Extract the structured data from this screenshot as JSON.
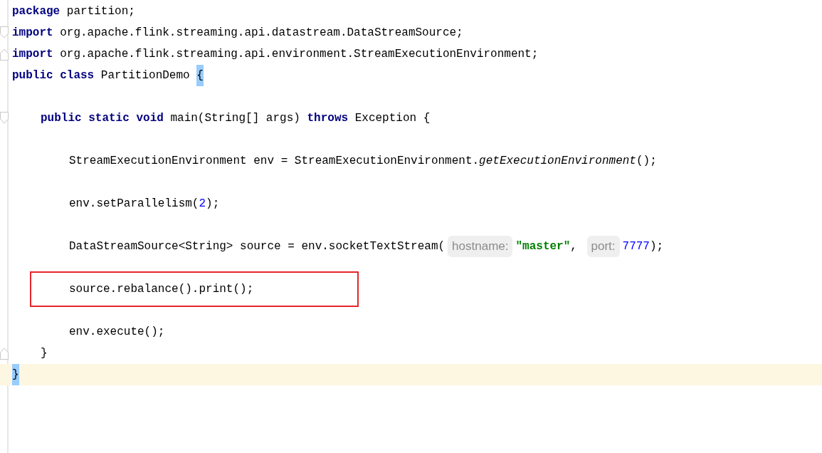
{
  "editor": {
    "lines": [
      {
        "tokens": [
          {
            "text": "package",
            "kind": "keyword"
          },
          {
            "text": " partition;",
            "kind": "plain"
          }
        ]
      },
      {
        "fold_start": true,
        "tokens": [
          {
            "text": "import",
            "kind": "keyword"
          },
          {
            "text": " org.apache.flink.streaming.api.datastream.DataStreamSource;",
            "kind": "plain"
          }
        ]
      },
      {
        "fold_end": true,
        "tokens": [
          {
            "text": "import",
            "kind": "keyword"
          },
          {
            "text": " org.apache.flink.streaming.api.environment.StreamExecutionEnvironment;",
            "kind": "plain"
          }
        ]
      },
      {
        "blank_after": true,
        "tokens": [
          {
            "text": "public class",
            "kind": "keyword"
          },
          {
            "text": " PartitionDemo ",
            "kind": "plain"
          },
          {
            "text": "{",
            "kind": "brace_match"
          }
        ],
        "children": [
          {
            "fold_start": true,
            "blank_after": true,
            "tokens": [
              {
                "text": "public static void",
                "kind": "keyword"
              },
              {
                "text": " main(String[] args) ",
                "kind": "plain"
              },
              {
                "text": "throws",
                "kind": "keyword"
              },
              {
                "text": " Exception ",
                "kind": "plain"
              },
              {
                "text": "{",
                "kind": "brace"
              }
            ],
            "children": [
              {
                "blank_after": true,
                "tokens": [
                  {
                    "text": "StreamExecutionEnvironment env = StreamExecutionEnvironment.",
                    "kind": "plain"
                  },
                  {
                    "text": "getExecutionEnvironment",
                    "kind": "italic"
                  },
                  {
                    "text": "();",
                    "kind": "plain"
                  }
                ]
              },
              {
                "blank_after": true,
                "tokens": [
                  {
                    "text": "env.setParallelism(",
                    "kind": "plain"
                  },
                  {
                    "text": "2",
                    "kind": "number"
                  },
                  {
                    "text": ");",
                    "kind": "plain"
                  }
                ]
              },
              {
                "blank_after": true,
                "tokens": [
                  {
                    "text": "DataStreamSource<String> source = env.socketTextStream(",
                    "kind": "plain"
                  },
                  {
                    "text": "hostname:",
                    "kind": "hint"
                  },
                  {
                    "text": "\"master\"",
                    "kind": "string"
                  },
                  {
                    "text": ", ",
                    "kind": "plain"
                  },
                  {
                    "text": "port:",
                    "kind": "hint"
                  },
                  {
                    "text": "7777",
                    "kind": "number"
                  },
                  {
                    "text": ");",
                    "kind": "plain"
                  }
                ]
              },
              {
                "boxed": true,
                "blank_after": true,
                "tokens": [
                  {
                    "text": "source.rebalance().print();",
                    "kind": "plain"
                  }
                ]
              },
              {
                "tokens": [
                  {
                    "text": "env.execute();",
                    "kind": "plain"
                  }
                ]
              }
            ]
          },
          {
            "fold_end": true,
            "tokens": [
              {
                "text": "}",
                "kind": "brace"
              }
            ]
          }
        ]
      },
      {
        "current": true,
        "tokens": [
          {
            "text": "}",
            "kind": "brace_match"
          }
        ]
      }
    ]
  }
}
